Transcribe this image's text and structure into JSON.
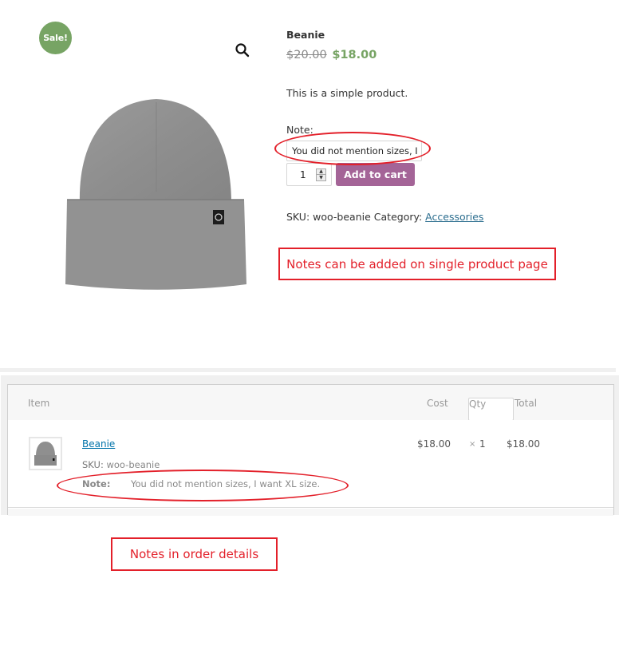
{
  "product": {
    "sale_badge": "Sale!",
    "title": "Beanie",
    "regular_price": "$20.00",
    "sale_price": "$18.00",
    "short_description": "This is a simple product.",
    "note_label": "Note:",
    "note_value": "You did not mention sizes, I",
    "quantity": "1",
    "add_to_cart_label": "Add to cart",
    "sku_label": "SKU:",
    "sku_value": "woo-beanie",
    "category_label": "Category:",
    "category_link": "Accessories",
    "zoom_icon": "search-icon"
  },
  "annotations": {
    "product_page": "Notes can be added on single product page",
    "order_details": "Notes in order details"
  },
  "order_items": {
    "columns": {
      "item": "Item",
      "cost": "Cost",
      "qty": "Qty",
      "total": "Total"
    },
    "rows": [
      {
        "name": "Beanie",
        "sku_label": "SKU:",
        "sku_value": "woo-beanie",
        "note_label": "Note:",
        "note_value": "You did not mention sizes, I want XL size.",
        "cost": "$18.00",
        "qty_prefix": "×",
        "qty": "1",
        "total": "$18.00"
      }
    ]
  },
  "colors": {
    "sale_green": "#77a464",
    "button_purple": "#a46497",
    "annotation_red": "#e3202a",
    "link_blue": "#0073aa"
  }
}
